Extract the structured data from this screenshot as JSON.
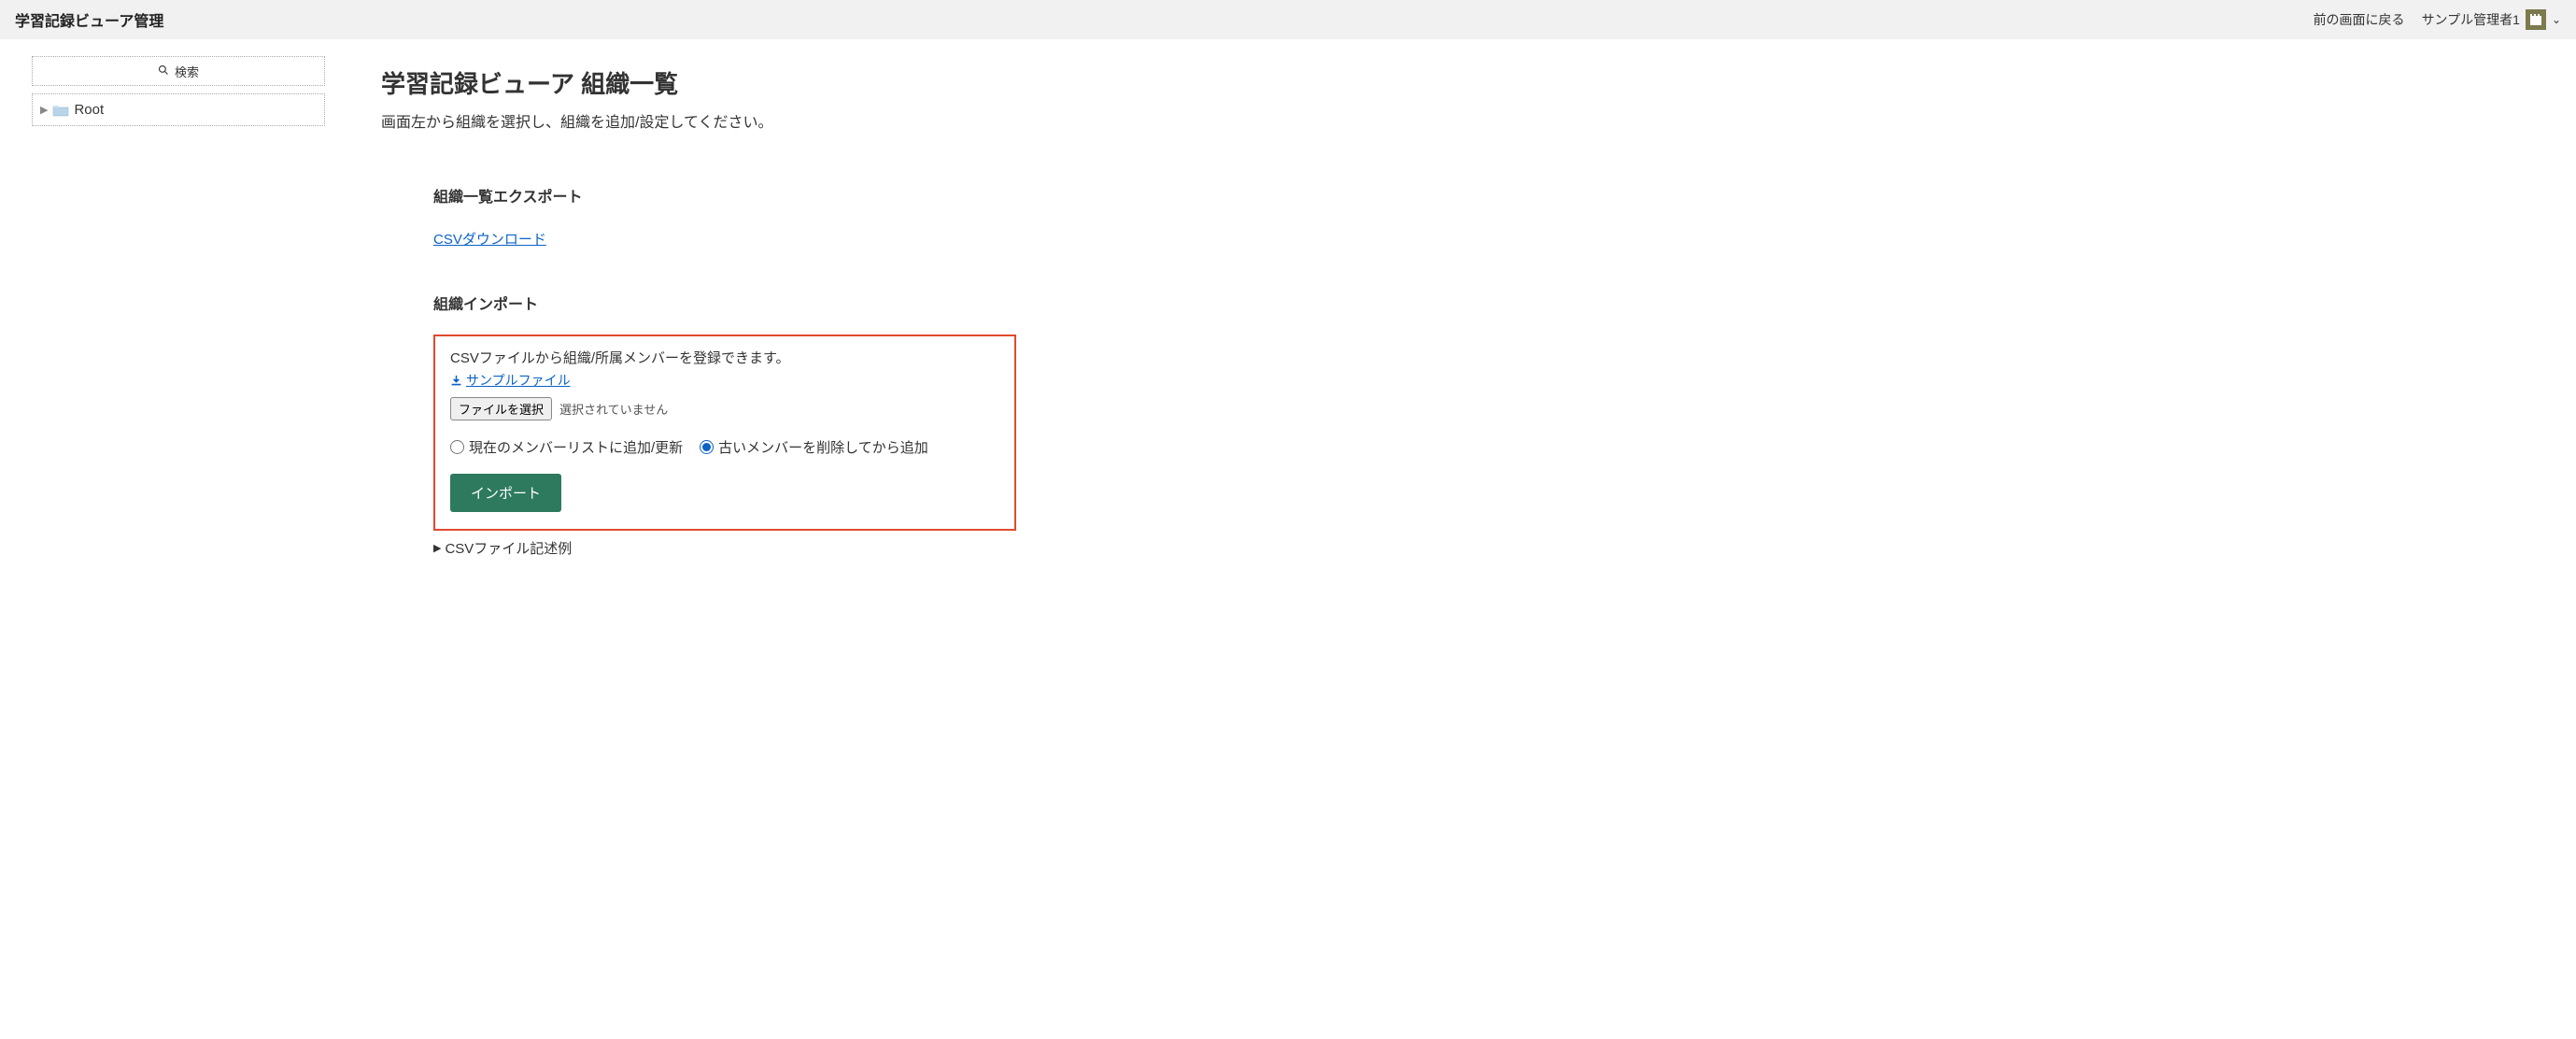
{
  "header": {
    "title": "学習記録ビューア管理",
    "back_link": "前の画面に戻る",
    "user_name": "サンプル管理者1"
  },
  "sidebar": {
    "search_label": "検索",
    "tree_root_label": "Root"
  },
  "main": {
    "title": "学習記録ビューア 組織一覧",
    "subtitle": "画面左から組織を選択し、組織を追加/設定してください。",
    "export": {
      "heading": "組織一覧エクスポート",
      "csv_download_label": "CSVダウンロード"
    },
    "import": {
      "heading": "組織インポート",
      "description": "CSVファイルから組織/所属メンバーを登録できます。",
      "sample_file_label": "サンプルファイル",
      "file_button_label": "ファイルを選択",
      "file_status": "選択されていません",
      "radio_option_1": "現在のメンバーリストに追加/更新",
      "radio_option_2": "古いメンバーを削除してから追加",
      "import_button_label": "インポート",
      "disclosure_label": "CSVファイル記述例"
    }
  }
}
